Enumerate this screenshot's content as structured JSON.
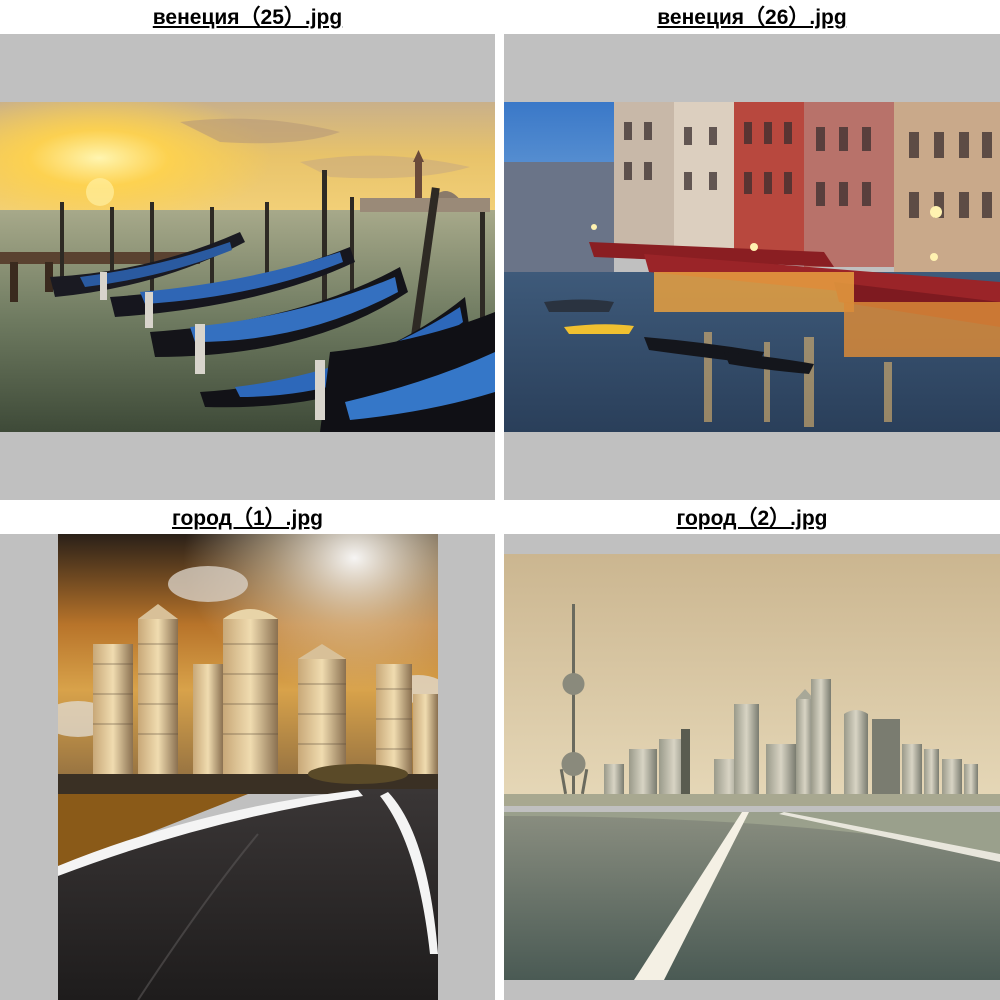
{
  "gallery": {
    "items": [
      {
        "filename": "венеция（25）.jpg",
        "subject": "gondolas moored at sunset in venice"
      },
      {
        "filename": "венеция（26）.jpg",
        "subject": "grand canal at dusk with lit restaurants"
      },
      {
        "filename": "город（1）.jpg",
        "subject": "city skyscrapers and curving road under amber sky"
      },
      {
        "filename": "город（2）.jpg",
        "subject": "city skyline with tv tower and straight road"
      }
    ]
  },
  "colors": {
    "frame_background": "#c0c0c0",
    "caption_text": "#000000",
    "page_background": "#ffffff"
  }
}
